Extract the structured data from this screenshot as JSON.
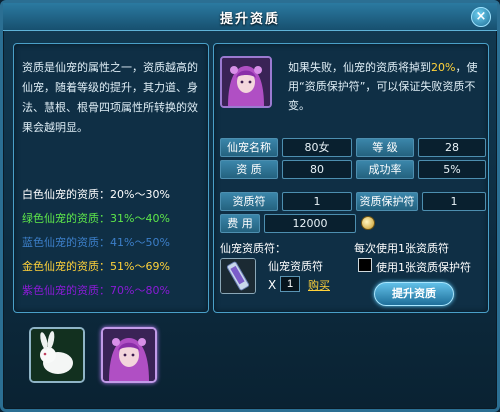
{
  "window": {
    "title": "提升资质",
    "close_symbol": "×"
  },
  "left_panel": {
    "description": "资质是仙宠的属性之一，资质越高的仙宠，随着等级的提升，其力道、身法、慧根、根骨四项属性所转换的效果会越明显。",
    "grades": [
      {
        "label": "白色仙宠的资质：",
        "range": "20%～30%",
        "color": "#ffffff"
      },
      {
        "label": "绿色仙宠的资质：",
        "range": "31%～40%",
        "color": "#5ee84a"
      },
      {
        "label": "蓝色仙宠的资质：",
        "range": "41%～50%",
        "color": "#3c7fc9"
      },
      {
        "label": "金色仙宠的资质：",
        "range": "51%～69%",
        "color": "#ffd23a"
      },
      {
        "label": "紫色仙宠的资质：",
        "range": "70%～80%",
        "color": "#8a1bd6"
      }
    ]
  },
  "right_panel": {
    "fail_note": {
      "part1": "如果失败，仙宠的资质将掉到",
      "percent": "20%",
      "part2": "，使用“资质保护符”，可以保证失败资质不变。"
    },
    "stats": {
      "name_label": "仙宠名称",
      "name_value": "80女",
      "level_label": "等  级",
      "level_value": "28",
      "quality_label": "资  质",
      "quality_value": "80",
      "success_label": "成功率",
      "success_value": "5%",
      "talisman_label": "资质符",
      "talisman_value": "1",
      "protect_label": "资质保护符",
      "protect_value": "1",
      "cost_label": "费 用",
      "cost_value": "12000"
    },
    "item": {
      "section_label": "仙宠资质符：",
      "name": "仙宠资质符",
      "qty_prefix": "X",
      "qty_value": "1",
      "buy_label": "购买"
    },
    "options": {
      "each_use": "每次使用1张资质符",
      "use_protect_label": "使用1张资质保护符",
      "use_protect_checked": false
    },
    "upgrade_button": "提升资质"
  },
  "pets": [
    {
      "name": "白兔"
    },
    {
      "name": "紫发仙子"
    }
  ],
  "colors": {
    "accent": "#2b7aa1",
    "highlight": "#ffd23a"
  }
}
